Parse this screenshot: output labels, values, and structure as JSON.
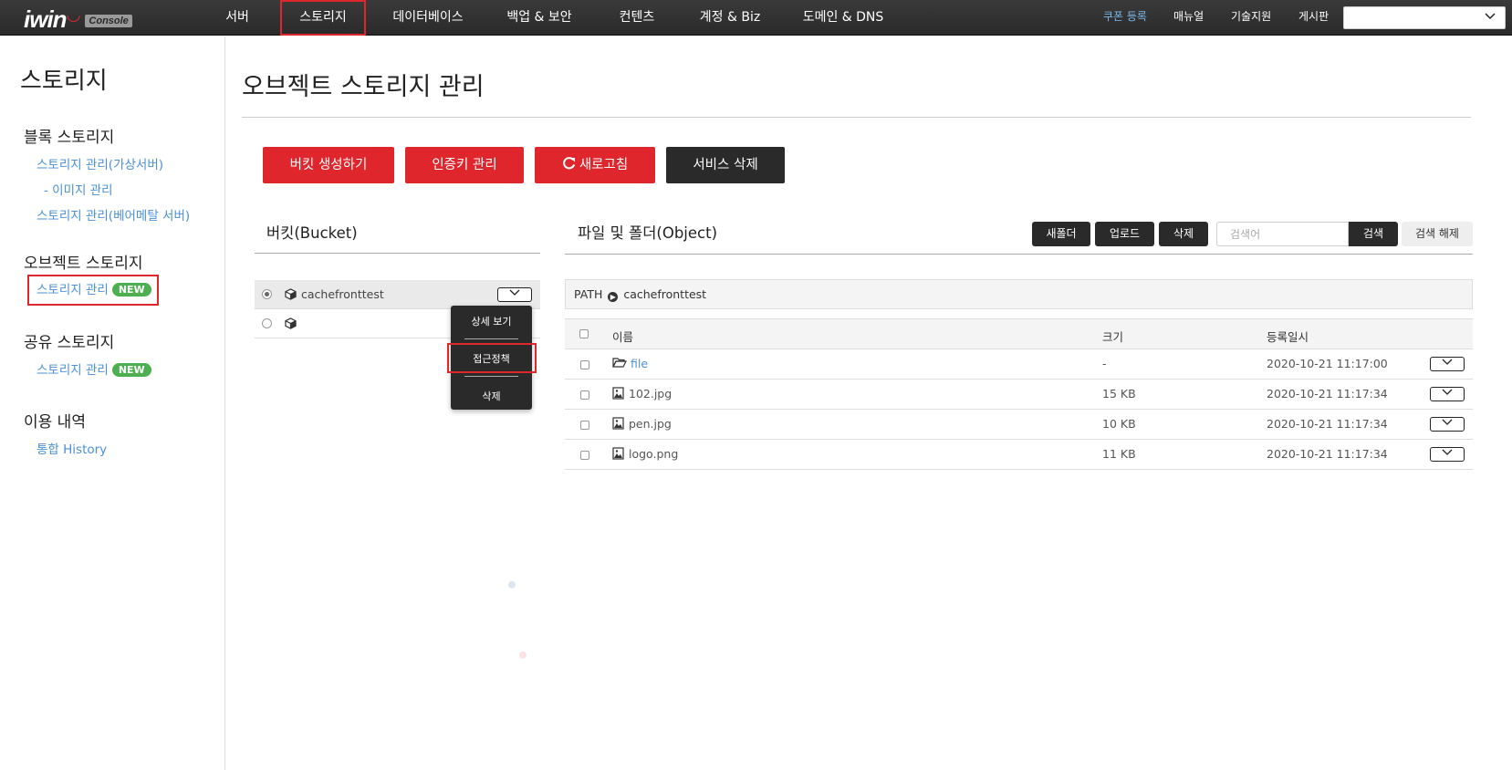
{
  "topbar": {
    "logo_text": "iwin",
    "logo_smile": "ᕫ",
    "logo_badge": "Console",
    "nav": [
      "서버",
      "스토리지",
      "데이터베이스",
      "백업 & 보안",
      "컨텐츠",
      "계정 & Biz",
      "도메인 & DNS"
    ],
    "util": [
      "쿠폰 등록",
      "매뉴얼",
      "기술지원",
      "게시판"
    ],
    "select_value": ""
  },
  "sidebar": {
    "title": "스토리지",
    "sections": [
      {
        "title": "블록 스토리지",
        "links": [
          "스토리지 관리(가상서버)",
          "- 이미지 관리",
          "스토리지 관리(베어메탈 서버)"
        ]
      },
      {
        "title": "오브젝트 스토리지",
        "links": [
          "스토리지 관리"
        ]
      },
      {
        "title": "공유 스토리지",
        "links": [
          "스토리지 관리"
        ]
      },
      {
        "title": "이용 내역",
        "links": [
          "통합 History"
        ]
      }
    ],
    "badge": "NEW"
  },
  "main": {
    "title": "오브젝트 스토리지 관리",
    "buttons": {
      "create_bucket": "버킷 생성하기",
      "auth_key": "인증키 관리",
      "refresh": "새로고침",
      "delete_service": "서비스 삭제"
    }
  },
  "bucket_panel": {
    "title": "버킷(Bucket)",
    "buckets": [
      {
        "name": "cachefronttest",
        "selected": true
      },
      {
        "name": "",
        "selected": false
      }
    ],
    "menu": [
      "상세 보기",
      "접근정책",
      "삭제"
    ]
  },
  "object_panel": {
    "title": "파일 및 폴더(Object)",
    "actions": {
      "new_folder": "새폴더",
      "upload": "업로드",
      "delete": "삭제",
      "search": "검색",
      "clear": "검색 해제"
    },
    "search_placeholder": "검색어",
    "path_label": "PATH",
    "path_value": "cachefronttest",
    "columns": {
      "name": "이름",
      "size": "크기",
      "date": "등록일시"
    },
    "rows": [
      {
        "icon": "folder-icon",
        "name": "file",
        "size": "-",
        "date": "2020-10-21 11:17:00"
      },
      {
        "icon": "image-icon",
        "name": "102.jpg",
        "size": "15 KB",
        "date": "2020-10-21 11:17:34"
      },
      {
        "icon": "image-icon",
        "name": "pen.jpg",
        "size": "10 KB",
        "date": "2020-10-21 11:17:34"
      },
      {
        "icon": "image-icon",
        "name": "logo.png",
        "size": "11 KB",
        "date": "2020-10-21 11:17:34"
      }
    ]
  },
  "colors": {
    "accent_red": "#e0262d",
    "dark": "#2a2a2a",
    "link_blue": "#4a90d9",
    "badge_green": "#4caf50"
  }
}
